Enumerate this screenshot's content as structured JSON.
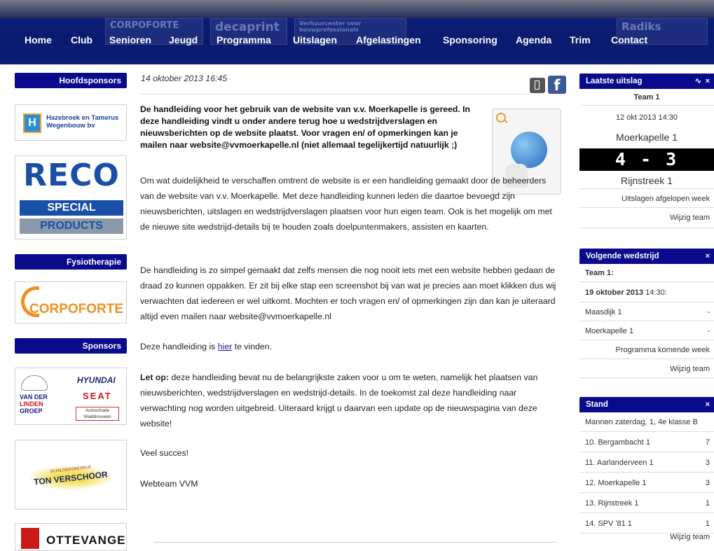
{
  "nav": [
    "Home",
    "Club",
    "Senioren",
    "Jeugd",
    "Programma",
    "Uitslagen",
    "Afgelastingen",
    "Sponsoring",
    "Agenda",
    "Trim",
    "Contact"
  ],
  "banner": [
    "CORPOFORTE",
    "decaprint",
    "Verhuurcenter voor bouwprofessionals",
    "Radiks"
  ],
  "left": {
    "hoofdsponsors": "Hoofdsponsors",
    "hazebroek": [
      "Hazebroek en Tamerus",
      "Wegenbouw bv"
    ],
    "reco": [
      "RECO",
      "SPECIAL",
      "PRODUCTS"
    ],
    "fysiotherapie": "Fysiotherapie",
    "corpoforte": "CORPOFORTE",
    "sponsors": "Sponsors",
    "vanderlinden": [
      "VAN DER",
      "LINDEN",
      "GROEP",
      "HYUNDAI",
      "SEAT",
      "Autoschade",
      "Waddinxveen"
    ],
    "ton": [
      "SCHILDERSBEDRIJF",
      "TON VERSCHOOR"
    ],
    "otte": "OTTEVANGER"
  },
  "main": {
    "date": "14 oktober 2013 16:45",
    "intro": "De handleiding voor het gebruik van de website van v.v. Moerkapelle is gereed. In deze handleiding vindt u onder andere terug hoe u wedstrijdverslagen en nieuwsberichten op de website plaatst. Voor vragen en/ of opmerkingen kan je mailen naar website@vvmoerkapelle.nl (niet allemaal tegelijkertijd natuurlijk ;)",
    "p1": "Om wat duidelijkheid te verschaffen omtrent de website is er een handleiding gemaakt door de beheerders van de website van v.v. Moerkapelle. Met deze handleiding kunnen leden die daartoe bevoegd zijn nieuwsberichten, uitslagen en wedstrijdverslagen plaatsen voor hun eigen team. Ook is het mogelijk om met de nieuwe site wedstrijd-details bij te houden zoals doelpuntenmakers, assisten en kaarten.",
    "p2": "De handleiding is zo simpel gemaakt dat zelfs mensen die nog nooit iets met een website hebben gedaan de draad zo kunnen oppakken. Er zit bij elke stap een screenshot bij van wat je precies aan moet klikken dus wij verwachten dat iedereen er wel uitkomt. Mochten er toch vragen en/ of opmerkingen zijn dan kan je uiteraard altijd even mailen naar website@vvmoerkapelle.nl",
    "p3_pre": "Deze handleiding is ",
    "p3_link": "hier",
    "p3_post": " te vinden.",
    "p4_bold": "Let op:",
    "p4": " deze handleiding bevat nu de belangrijkste zaken voor u om te weten, namelijk het plaatsen van nieuwsberichten, wedstrijdverslagen en wedstrijd-details. In de toekomst zal deze handleiding naar verwachting nog worden uitgebreid. Uiteraard krijgt u daarvan een update op de nieuwspagina van deze website!",
    "p5": "Veel succes!",
    "p6": "Webteam VVM"
  },
  "right": {
    "laatste": {
      "title": "Laatste uitslag",
      "team": "Team 1",
      "date": "12 okt 2013 14:30",
      "home": "Moerkapelle 1",
      "score": "4 - 3",
      "away": "Rijnstreek 1",
      "link1": "Uitslagen afgelopen week",
      "link2": "Wijzig team"
    },
    "volgende": {
      "title": "Volgende wedstrijd",
      "team": "Team 1:",
      "date_bold": "19 oktober 2013",
      "time": " 14:30:",
      "home": "Maasdijk 1",
      "away": "Moerkapelle 1",
      "dash": "-",
      "link1": "Programma komende week",
      "link2": "Wijzig team"
    },
    "stand": {
      "title": "Stand",
      "league": "Mannen zaterdag, 1, 4e klasse B",
      "rows": [
        {
          "team": "10. Bergambacht 1",
          "pts": "7"
        },
        {
          "team": "11. Aarlanderveen 1",
          "pts": "3"
        },
        {
          "team": "12. Moerkapelle 1",
          "pts": "3"
        },
        {
          "team": "13. Rijnstreek 1",
          "pts": "1"
        },
        {
          "team": "14. SPV '81 1",
          "pts": "1"
        }
      ],
      "link": "Wijzig team"
    },
    "close": "×"
  }
}
